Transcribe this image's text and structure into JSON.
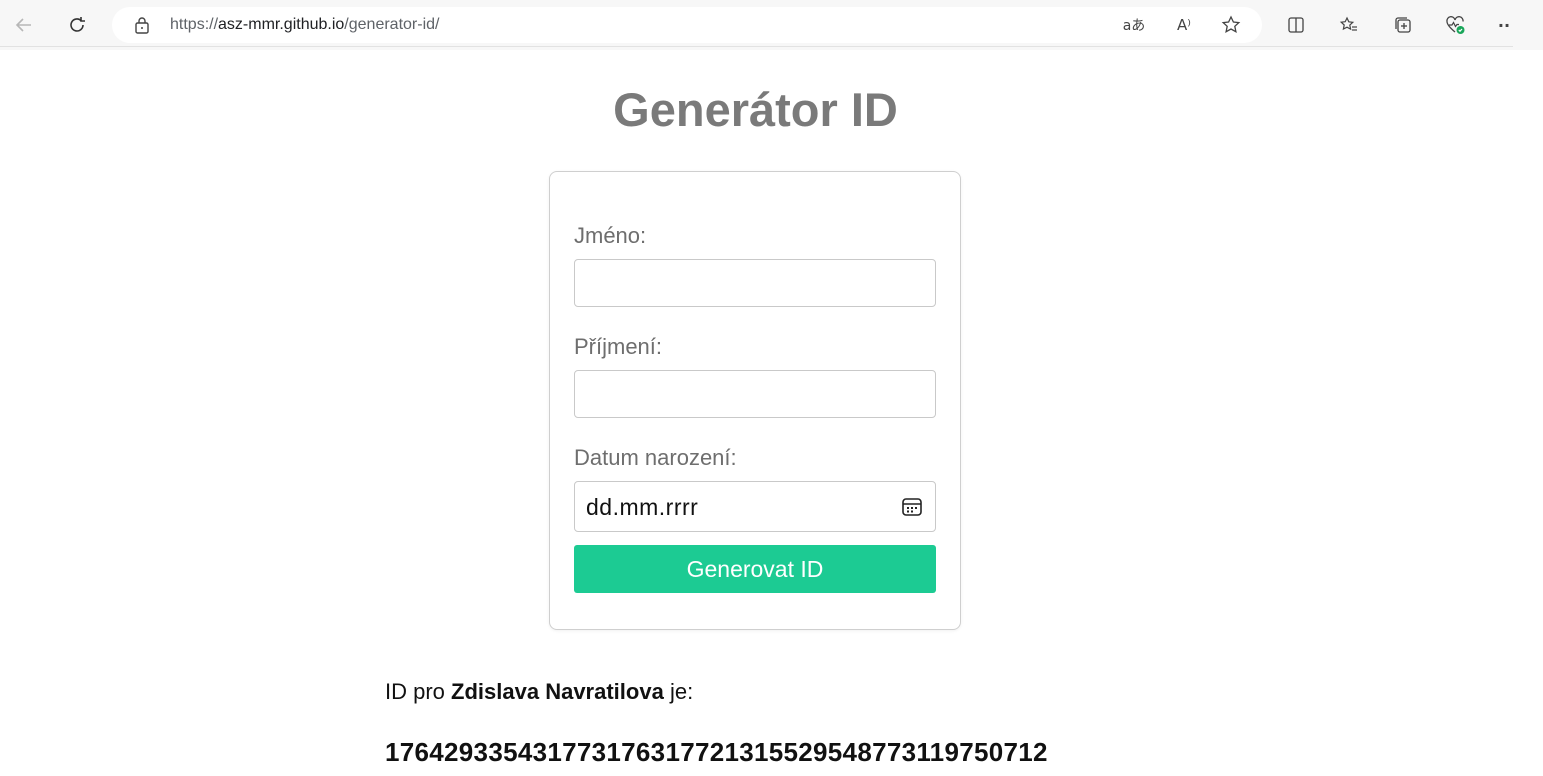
{
  "browser": {
    "url_scheme": "https://",
    "url_host": "asz-mmr.github.io",
    "url_path": "/generator-id/",
    "translate_glyph": "aあ",
    "read_aloud_glyph": "A⁾",
    "more_glyph": "··"
  },
  "page": {
    "title": "Generátor ID"
  },
  "form": {
    "first_name_label": "Jméno:",
    "first_name_value": "",
    "last_name_label": "Příjmení:",
    "last_name_value": "",
    "birthdate_label": "Datum narození:",
    "birthdate_placeholder": "dd.mm.rrrr",
    "submit_label": "Generovat ID"
  },
  "result": {
    "prefix": "ID pro",
    "name": "Zdislava Navratilova",
    "suffix": "je:",
    "id_value": "176429335431773176317721315529548773119750712"
  },
  "colors": {
    "accent": "#1ccb93",
    "title": "#7a7a7a",
    "label": "#6e6e6e"
  }
}
